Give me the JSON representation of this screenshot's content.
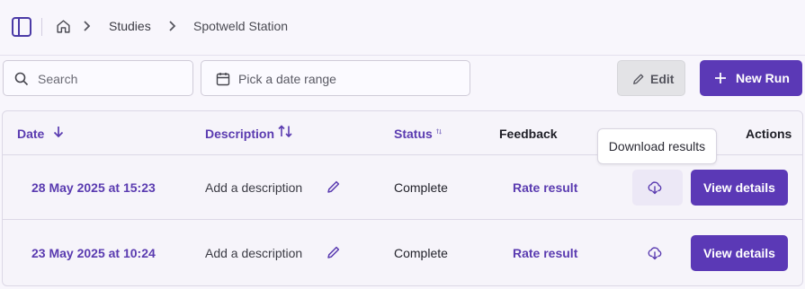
{
  "breadcrumb": [
    "Studies",
    "Spotweld Station"
  ],
  "search": {
    "placeholder": "Search",
    "value": ""
  },
  "date_range": {
    "placeholder": "Pick a date range"
  },
  "toolbar": {
    "edit_label": "Edit",
    "new_run_label": "New Run"
  },
  "table": {
    "headers": {
      "date": "Date",
      "description": "Description",
      "status": "Status",
      "feedback": "Feedback",
      "actions": "Actions"
    },
    "rows": [
      {
        "date": "28 May 2025 at 15:23",
        "description": "Add a description",
        "status": "Complete",
        "feedback": "Rate result",
        "action": "View details"
      },
      {
        "date": "23 May 2025 at 10:24",
        "description": "Add a description",
        "status": "Complete",
        "feedback": "Rate result",
        "action": "View details"
      }
    ]
  },
  "tooltip": {
    "text": "Download results"
  },
  "colors": {
    "accent": "#5b39b6",
    "background": "#f8f6fc",
    "border": "#dcd8e6"
  },
  "icons": [
    "sidebar-toggle-icon",
    "home-icon",
    "chevron-right-icon",
    "search-icon",
    "calendar-icon",
    "pencil-icon",
    "plus-icon",
    "arrow-down-icon",
    "sort-icon",
    "download-cloud-icon"
  ]
}
